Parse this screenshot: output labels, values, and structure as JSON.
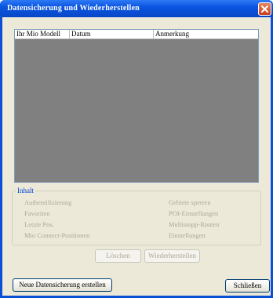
{
  "window": {
    "title": "Datensicherung und Wiederherstellen"
  },
  "list": {
    "columns": [
      "Ihr Mio Modell",
      "Datum",
      "Anmerkung"
    ]
  },
  "group": {
    "title": "Inhalt",
    "items_left": [
      "Authentifizierung",
      "Favoriten",
      "Letzte Pos.",
      "Mio Connect-Positionen"
    ],
    "items_right": [
      "Gebiete sperren",
      "POI-Einstellungen",
      "Multistopp-Routen",
      "Einstellungen"
    ]
  },
  "buttons": {
    "delete": "Löschen",
    "restore": "Wiederherstellen",
    "new_backup": "Neue Datensicherung erstellen",
    "close": "Schließen"
  },
  "colors": {
    "titlebar": "#0a55e0",
    "dialog_bg": "#ece9d8",
    "list_bg": "#808080",
    "group_title": "#0046d5",
    "disabled_text": "#aca899"
  }
}
